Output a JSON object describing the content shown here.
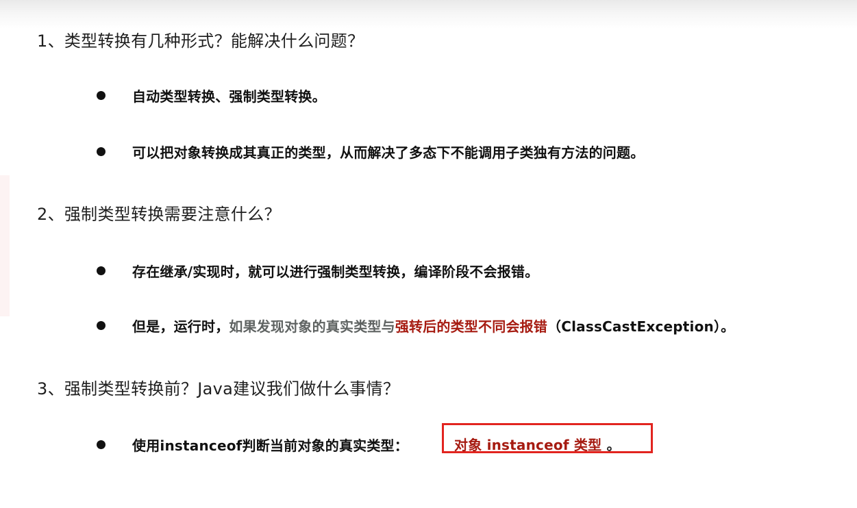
{
  "q1": {
    "heading": "1、类型转换有几种形式？能解决什么问题？",
    "bullets": [
      "自动类型转换、强制类型转换。",
      "可以把对象转换成其真正的类型，从而解决了多态下不能调用子类独有方法的问题。"
    ]
  },
  "q2": {
    "heading": "2、强制类型转换需要注意什么？",
    "bullet1": "存在继承/实现时，就可以进行强制类型转换，编译阶段不会报错。",
    "bullet2": {
      "part1": "但是，运行时，",
      "part2": "如果发现对象的真实类型与",
      "part3": "强转后的类型不同会报错",
      "part4": "（ClassCastException）。"
    }
  },
  "q3": {
    "heading": "3、强制类型转换前？Java建议我们做什么事情？",
    "bullet": {
      "prefix": "使用instanceof判断当前对象的真实类型：",
      "highlight": "对象 instanceof 类型",
      "suffix": " 。"
    }
  },
  "colors": {
    "text": "#111111",
    "gray_text": "#5f6362",
    "red_text": "#a61b11",
    "box_border": "#e2241f"
  }
}
